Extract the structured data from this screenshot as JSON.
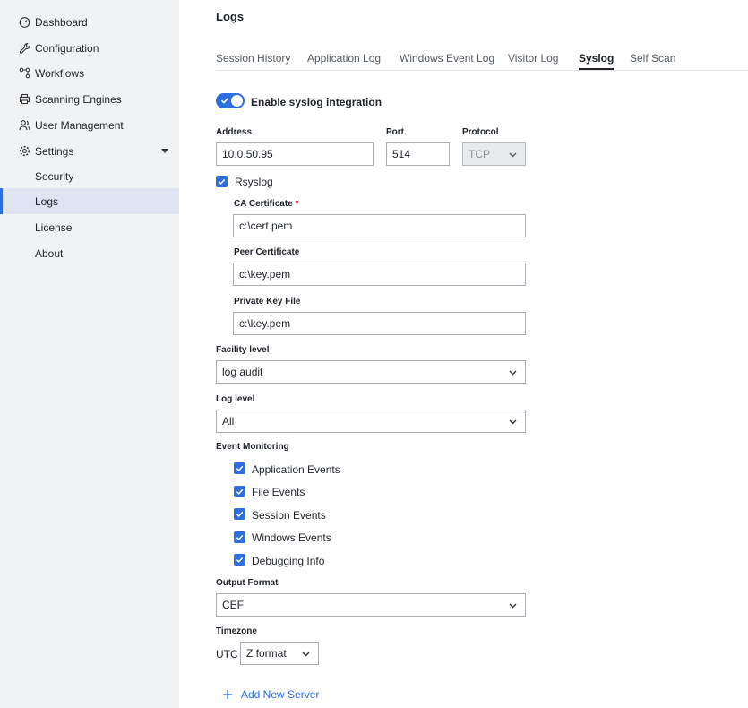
{
  "sidebar": {
    "items": [
      {
        "label": "Dashboard",
        "icon": "dashboard-icon"
      },
      {
        "label": "Configuration",
        "icon": "wrench-icon"
      },
      {
        "label": "Workflows",
        "icon": "workflow-icon"
      },
      {
        "label": "Scanning Engines",
        "icon": "printer-icon"
      },
      {
        "label": "User Management",
        "icon": "users-icon"
      },
      {
        "label": "Settings",
        "icon": "gear-icon"
      }
    ],
    "settings_sub": [
      "Security",
      "Logs",
      "License",
      "About"
    ],
    "active": "Logs"
  },
  "page": {
    "title": "Logs"
  },
  "tabs": [
    "Session History",
    "Application Log",
    "Windows Event Log",
    "Visitor Log",
    "Syslog",
    "Self Scan"
  ],
  "active_tab": "Syslog",
  "syslog": {
    "enable_label": "Enable syslog integration",
    "enabled": true,
    "address_label": "Address",
    "address_value": "10.0.50.95",
    "port_label": "Port",
    "port_value": "514",
    "protocol_label": "Protocol",
    "protocol_value": "TCP",
    "rsyslog_label": "Rsyslog",
    "ca_label": "CA Certificate",
    "ca_required": "*",
    "ca_value": "c:\\cert.pem",
    "peer_label": "Peer Certificate",
    "peer_value": "c:\\key.pem",
    "pkey_label": "Private Key File",
    "pkey_value": "c:\\key.pem",
    "facility_label": "Facility level",
    "facility_value": "log audit",
    "loglevel_label": "Log level",
    "loglevel_value": "All",
    "event_label": "Event Monitoring",
    "events": [
      "Application Events",
      "File Events",
      "Session Events",
      "Windows Events",
      "Debugging Info"
    ],
    "output_label": "Output Format",
    "output_value": "CEF",
    "timezone_label": "Timezone",
    "utc_label": "UTC",
    "tz_value": "Z format",
    "add_server_label": "Add New Server"
  },
  "colors": {
    "accent": "#2d6fe0",
    "sidebar_bg": "#f1f2f4",
    "active_bg": "#dfe3f2"
  }
}
